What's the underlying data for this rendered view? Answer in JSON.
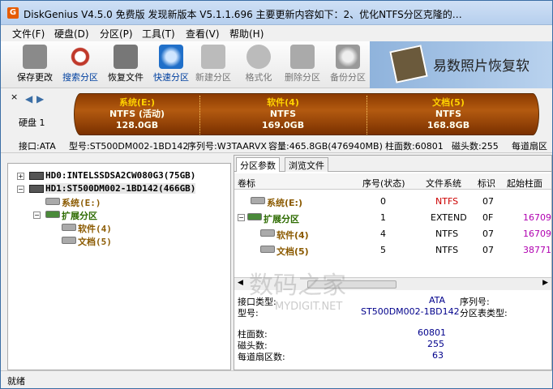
{
  "window": {
    "title": "DiskGenius V4.5.0 免费版  发现新版本 V5.1.1.696 主要更新内容如下：2、优化NTFS分区克隆的…",
    "icon_letter": "G"
  },
  "menu": [
    "文件(F)",
    "硬盘(D)",
    "分区(P)",
    "工具(T)",
    "查看(V)",
    "帮助(H)"
  ],
  "toolbar": [
    {
      "label": "保存更改",
      "icon": "save-icon"
    },
    {
      "label": "搜索分区",
      "icon": "search-partition-icon"
    },
    {
      "label": "恢复文件",
      "icon": "restore-file-icon"
    },
    {
      "label": "快速分区",
      "icon": "quick-partition-icon"
    },
    {
      "label": "新建分区",
      "icon": "new-partition-icon"
    },
    {
      "label": "格式化",
      "icon": "format-icon"
    },
    {
      "label": "删除分区",
      "icon": "delete-partition-icon"
    },
    {
      "label": "备份分区",
      "icon": "backup-partition-icon"
    }
  ],
  "banner": {
    "text": "易数照片恢复软"
  },
  "disk_map": {
    "disk_label": "硬盘 1",
    "partitions": [
      {
        "name": "系统(E:)",
        "fs": "NTFS (活动)",
        "size": "128.0GB"
      },
      {
        "name": "软件(4)",
        "fs": "NTFS",
        "size": "169.0GB"
      },
      {
        "name": "文档(5)",
        "fs": "NTFS",
        "size": "168.8GB"
      }
    ]
  },
  "disk_info": {
    "interface": "接口:ATA",
    "model": "型号:ST500DM002-1BD142",
    "serial": "序列号:W3TAARVX",
    "capacity": "容量:465.8GB(476940MB)",
    "cylinders": "柱面数:60801",
    "heads": "磁头数:255",
    "sectors": "每道扇区"
  },
  "tree": {
    "hd0": "HD0:INTELSSDSA2CW080G3(75GB)",
    "hd1": "HD1:ST500DM002-1BD142(466GB)",
    "sys": "系统(E:)",
    "ext": "扩展分区",
    "soft": "软件(4)",
    "doc": "文档(5)"
  },
  "tabs": [
    "分区参数",
    "浏览文件"
  ],
  "table": {
    "headers": [
      "卷标",
      "序号(状态)",
      "文件系统",
      "标识",
      "起始柱面"
    ],
    "rows": [
      {
        "name": "系统(E:)",
        "seq": "0",
        "fs": "NTFS",
        "id": "07",
        "start": ""
      },
      {
        "name": "扩展分区",
        "seq": "1",
        "fs": "EXTEND",
        "id": "0F",
        "start": "16709"
      },
      {
        "name": "软件(4)",
        "seq": "4",
        "fs": "NTFS",
        "id": "07",
        "start": "16709"
      },
      {
        "name": "文档(5)",
        "seq": "5",
        "fs": "NTFS",
        "id": "07",
        "start": "38771"
      }
    ]
  },
  "details": {
    "iface_label": "接口类型:",
    "iface_value": "ATA",
    "serial_label": "序列号:",
    "model_label": "型号:",
    "model_value": "ST500DM002-1BD142",
    "pttype_label": "分区表类型:",
    "cyl_label": "柱面数:",
    "cyl_value": "60801",
    "heads_label": "磁头数:",
    "heads_value": "255",
    "spt_label": "每道扇区数:",
    "spt_value": "63"
  },
  "watermark": {
    "text": "数码之家",
    "sub": "MYDIGIT.NET"
  },
  "status": {
    "text": "就绪"
  },
  "colors": {
    "partition_bar": "#b35a10",
    "partition_name": "#ffd200"
  }
}
